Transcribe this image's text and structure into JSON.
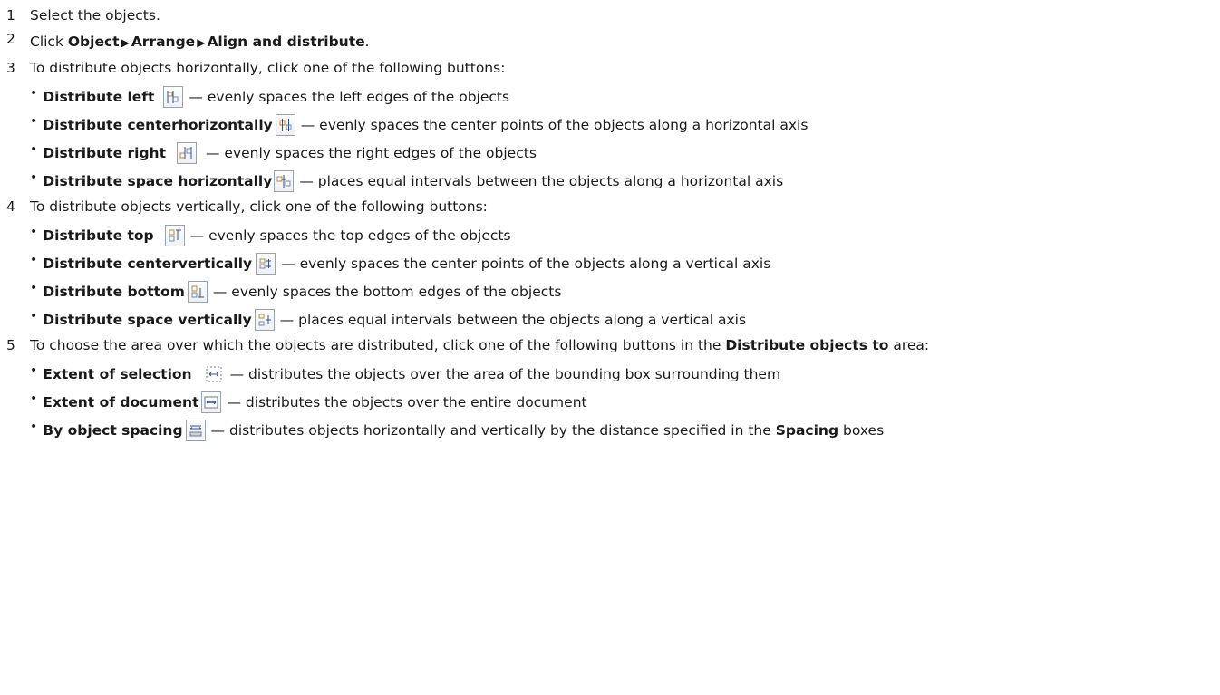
{
  "steps": [
    {
      "num": "1",
      "text": "Select the objects."
    },
    {
      "num": "2",
      "pre": "Click ",
      "menu": [
        "Object",
        "Arrange",
        "Align and distribute"
      ],
      "post": "."
    },
    {
      "num": "3",
      "text": "To distribute objects horizontally, click one of the following buttons:"
    },
    {
      "num": "4",
      "text": "To distribute objects vertically, click one of the following buttons:"
    },
    {
      "num": "5",
      "pre": "To choose the area over which the objects are distributed, click one of the following buttons in the ",
      "bold": "Distribute objects to",
      "post": " area:"
    }
  ],
  "separator": "▶",
  "bullet": "•",
  "horizontal_items": [
    {
      "label": "Distribute left",
      "icon": "distribute-left-icon",
      "desc": "— evenly spaces the left edges of the objects"
    },
    {
      "label": "Distribute centerhorizontally",
      "icon": "distribute-center-horizontally-icon",
      "desc": "— evenly spaces the center points of the objects along a horizontal axis"
    },
    {
      "label": "Distribute right",
      "icon": "distribute-right-icon",
      "desc": "—  evenly spaces the right edges of the objects"
    },
    {
      "label": "Distribute space horizontally",
      "icon": "distribute-space-horizontally-icon",
      "desc": "— places equal intervals between the objects along a horizontal axis"
    }
  ],
  "vertical_items": [
    {
      "label": "Distribute top",
      "icon": "distribute-top-icon",
      "desc": "— evenly spaces the top edges of the objects"
    },
    {
      "label": "Distribute centervertically",
      "icon": "distribute-center-vertically-icon",
      "desc": "— evenly spaces the center points of the objects along a vertical axis"
    },
    {
      "label": "Distribute bottom",
      "icon": "distribute-bottom-icon",
      "desc": "— evenly spaces the bottom edges of the objects"
    },
    {
      "label": "Distribute space vertically",
      "icon": "distribute-space-vertically-icon",
      "desc": "— places equal intervals between the objects along a vertical axis"
    }
  ],
  "area_items": [
    {
      "label": "Extent of selection",
      "icon": "extent-of-selection-icon",
      "desc": "— distributes the objects over the area of the bounding box surrounding them"
    },
    {
      "label": "Extent of document",
      "icon": "extent-of-document-icon",
      "desc": "— distributes the objects over the entire document"
    },
    {
      "label": "By object spacing",
      "icon": "by-object-spacing-icon",
      "desc_pre": "— distributes objects horizontally and vertically by the distance specified in the ",
      "desc_bold": "Spacing",
      "desc_post": " boxes"
    }
  ]
}
